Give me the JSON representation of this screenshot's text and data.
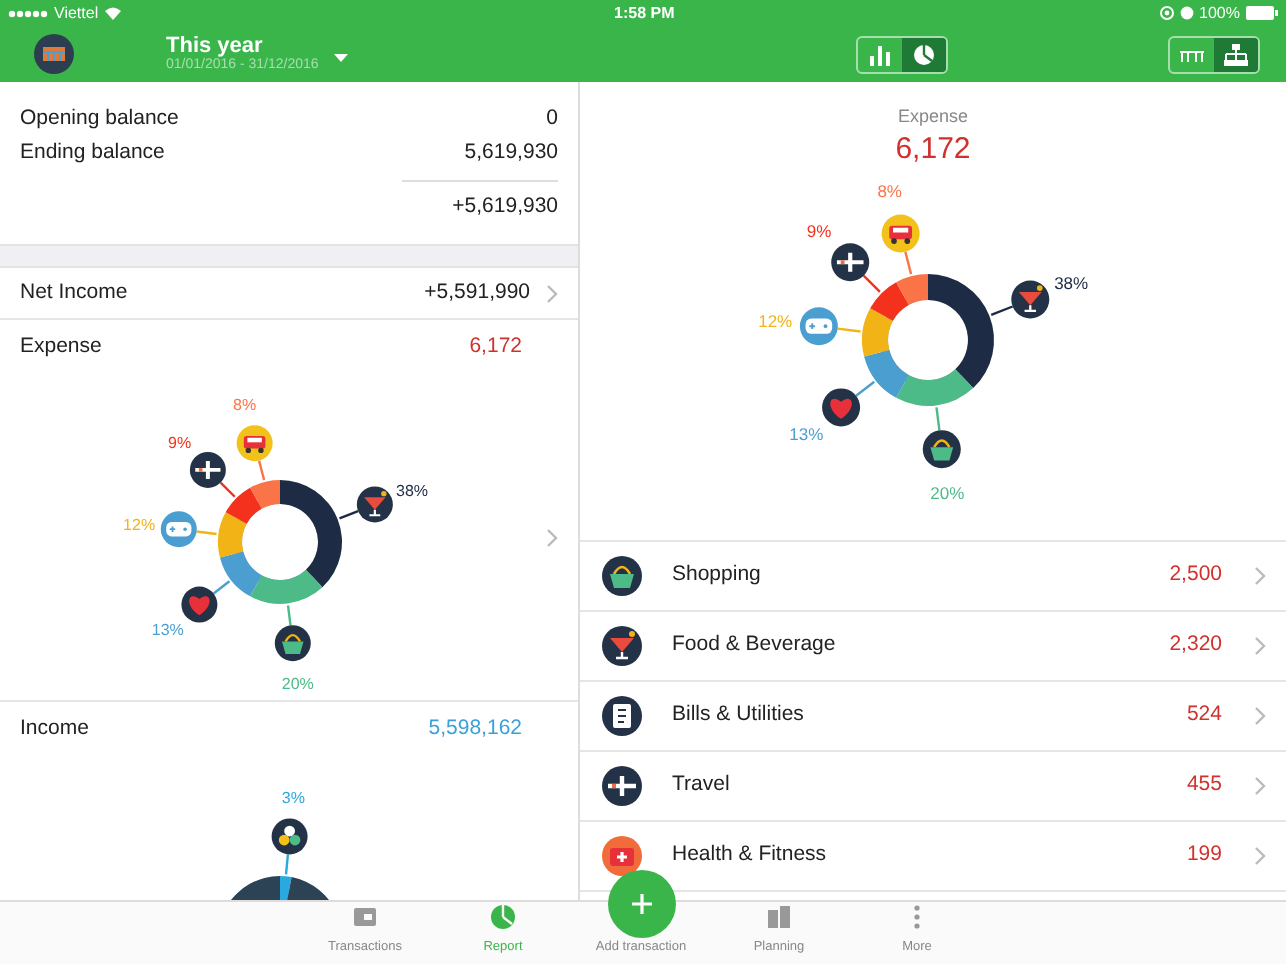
{
  "status_bar": {
    "carrier": "Viettel",
    "time": "1:58 PM",
    "battery": "100%"
  },
  "header": {
    "period": "This year",
    "date_range": "01/01/2016 - 31/12/2016",
    "chart_toggle": [
      {
        "kind": "bar",
        "selected": false
      },
      {
        "kind": "pie",
        "selected": true
      }
    ],
    "view_toggle": [
      {
        "kind": "flat",
        "selected": false
      },
      {
        "kind": "tree",
        "selected": true
      }
    ]
  },
  "summary": {
    "rows": [
      {
        "label": "Opening balance",
        "value": "0"
      },
      {
        "label": "Ending balance",
        "value": "5,619,930"
      }
    ],
    "difference": "+5,619,930"
  },
  "net_income": {
    "label": "Net Income",
    "value": "+5,591,990"
  },
  "expense": {
    "label": "Expense",
    "value": "6,172",
    "slices": [
      {
        "kind": "cocktail",
        "color": "#1d2b44",
        "percent": "38%"
      },
      {
        "kind": "basket",
        "color": "#4dbb87",
        "percent": "20%"
      },
      {
        "kind": "heart",
        "color": "#4a9fd0",
        "percent": "13%"
      },
      {
        "kind": "gamepad",
        "color": "#f2b316",
        "percent": "12%"
      },
      {
        "kind": "plane",
        "color": "#f4311c",
        "percent": "9%"
      },
      {
        "kind": "car",
        "color": "#fb7448",
        "percent": "8%"
      }
    ],
    "chart_data": {
      "type": "donut",
      "values": [
        38,
        20,
        13,
        12,
        9,
        8
      ]
    }
  },
  "income": {
    "label": "Income",
    "value": "5,598,162",
    "slices": [
      {
        "kind": "coins",
        "color": "#2aa8e0",
        "percent": "3%"
      },
      {
        "kind": "none",
        "color": "#2c4356"
      }
    ],
    "chart_data": {
      "type": "donut",
      "values": [
        3,
        97
      ]
    }
  },
  "detail": {
    "label": "Expense",
    "value": "6,172",
    "slices": [
      {
        "kind": "cocktail",
        "color": "#1d2b44",
        "percent": "38%"
      },
      {
        "kind": "basket",
        "color": "#4dbb87",
        "percent": "20%"
      },
      {
        "kind": "heart",
        "color": "#4a9fd0",
        "percent": "13%"
      },
      {
        "kind": "gamepad",
        "color": "#f2b316",
        "percent": "12%"
      },
      {
        "kind": "plane",
        "color": "#f4311c",
        "percent": "9%"
      },
      {
        "kind": "car",
        "color": "#fb7448",
        "percent": "8%"
      }
    ],
    "chart_data": {
      "type": "donut",
      "values": [
        38,
        20,
        13,
        12,
        9,
        8
      ]
    },
    "categories": [
      {
        "kind": "basket",
        "name": "Shopping",
        "amount": "2,500"
      },
      {
        "kind": "cocktail",
        "name": "Food & Beverage",
        "amount": "2,320"
      },
      {
        "kind": "bills",
        "name": "Bills & Utilities",
        "amount": "524"
      },
      {
        "kind": "plane",
        "name": "Travel",
        "amount": "455"
      },
      {
        "kind": "health",
        "name": "Health & Fitness",
        "amount": "199"
      }
    ]
  },
  "tab_bar": [
    {
      "kind": "wallet",
      "label": "Transactions",
      "selected": false
    },
    {
      "kind": "report",
      "label": "Report",
      "selected": true
    },
    {
      "kind": "add",
      "label": "Add transaction",
      "selected": false
    },
    {
      "kind": "planning",
      "label": "Planning",
      "selected": false
    },
    {
      "kind": "more",
      "label": "More",
      "selected": false
    }
  ]
}
